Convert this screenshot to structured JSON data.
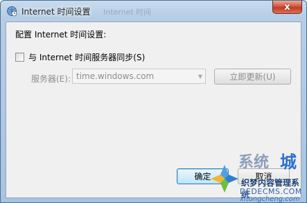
{
  "window": {
    "title": "Internet 时间设置",
    "background_title": "Internet 时间",
    "close_label": "x"
  },
  "dialog": {
    "heading": "配置 Internet 时间设置:",
    "sync_checkbox": {
      "label": "与 Internet 时间服务器同步(S)",
      "checked": false
    },
    "server_label": "服务器(E):",
    "server_value": "time.windows.com",
    "update_button": "立即更新(U)",
    "ok_button": "确定",
    "cancel_button": "取消"
  },
  "watermark": {
    "brand": "系统",
    "brand_right": "城",
    "line1": "织梦内容管理系统",
    "line2": "DEDECMS.COM",
    "line3": "xitongcheng.com"
  },
  "colors": {
    "close_button": "#c23b22",
    "ok_button_border": "#3c7fb1",
    "watermark_blue": "#2c6fd0"
  }
}
